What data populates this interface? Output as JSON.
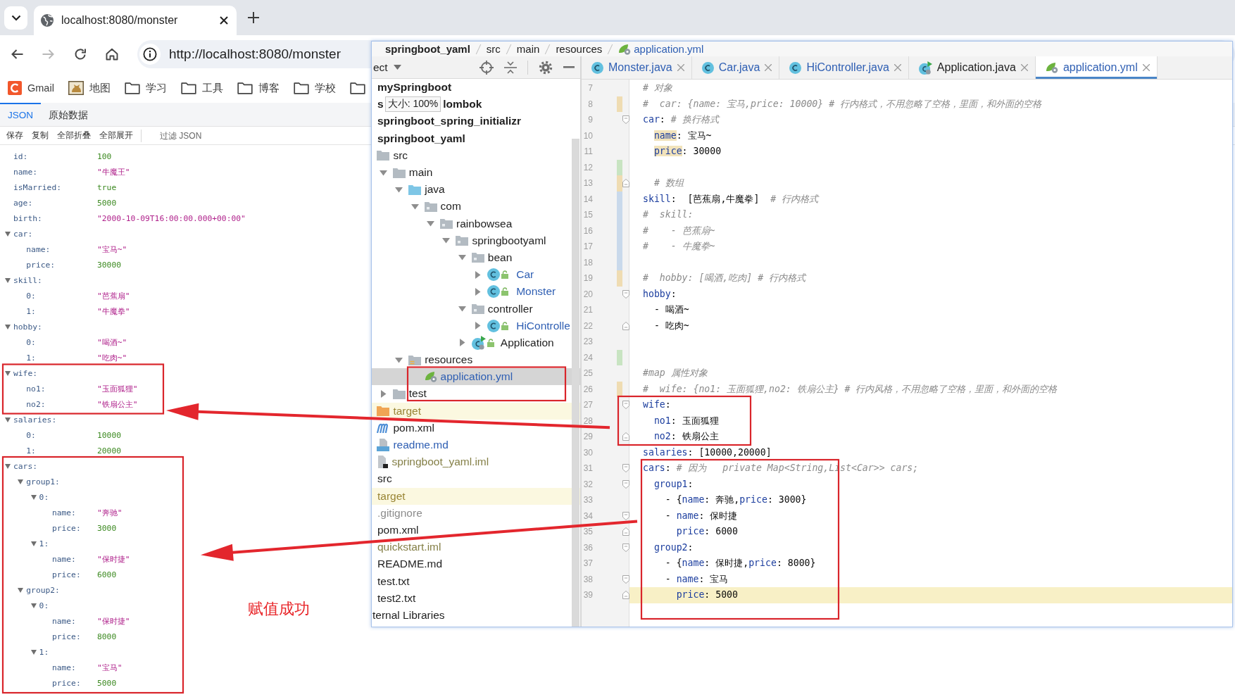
{
  "browser": {
    "tab": {
      "title": "localhost:8080/monster"
    },
    "nav_buttons": [
      {
        "kind": "back",
        "disabled": false
      },
      {
        "kind": "forward",
        "disabled": true
      },
      {
        "kind": "reload",
        "disabled": false
      },
      {
        "kind": "home",
        "disabled": false
      }
    ],
    "address_bar": {
      "url": "http://localhost:8080/monster"
    },
    "bookmarks": [
      {
        "label": "Gmail",
        "kind": "logo"
      },
      {
        "label": "地图",
        "kind": "picture"
      },
      {
        "label": "学习",
        "kind": "folder"
      },
      {
        "label": "工具",
        "kind": "folder"
      },
      {
        "label": "博客",
        "kind": "folder"
      },
      {
        "label": "学校",
        "kind": "folder"
      },
      {
        "kind": "folder"
      }
    ]
  },
  "json_viewer": {
    "tabs": [
      {
        "label": "JSON",
        "selected": true
      },
      {
        "label": "原始数据",
        "selected": false
      }
    ],
    "actions": [
      "保存",
      "复制",
      "全部折叠",
      "全部展开"
    ],
    "filter": {
      "placeholder": "过滤 JSON"
    },
    "tree": [
      {
        "key": "id:",
        "value": "100",
        "kind": "number"
      },
      {
        "key": "name:",
        "value": "\"牛魔王\"",
        "kind": "string"
      },
      {
        "key": "isMarried:",
        "value": "true",
        "kind": "boolean"
      },
      {
        "key": "age:",
        "value": "5000",
        "kind": "number"
      },
      {
        "key": "birth:",
        "value": "\"2000-10-09T16:00:00.000+00:00\"",
        "kind": "string"
      },
      {
        "key": "car:",
        "expanded": true,
        "children": [
          {
            "key": "name:",
            "value": "\"宝马~\"",
            "kind": "string"
          },
          {
            "key": "price:",
            "value": "30000",
            "kind": "number"
          }
        ]
      },
      {
        "key": "skill:",
        "expanded": true,
        "children": [
          {
            "key": "0:",
            "value": "\"芭蕉扇\"",
            "kind": "string"
          },
          {
            "key": "1:",
            "value": "\"牛魔拳\"",
            "kind": "string"
          }
        ]
      },
      {
        "key": "hobby:",
        "expanded": true,
        "children": [
          {
            "key": "0:",
            "value": "\"喝酒~\"",
            "kind": "string"
          },
          {
            "key": "1:",
            "value": "\"吃肉~\"",
            "kind": "string"
          }
        ]
      },
      {
        "key": "wife:",
        "expanded": true,
        "children": [
          {
            "key": "no1:",
            "value": "\"玉面狐狸\"",
            "kind": "string"
          },
          {
            "key": "no2:",
            "value": "\"铁扇公主\"",
            "kind": "string"
          }
        ]
      },
      {
        "key": "salaries:",
        "expanded": true,
        "children": [
          {
            "key": "0:",
            "value": "10000",
            "kind": "number"
          },
          {
            "key": "1:",
            "value": "20000",
            "kind": "number"
          }
        ]
      },
      {
        "key": "cars:",
        "expanded": true,
        "children": [
          {
            "key": "group1:",
            "expanded": true,
            "children": [
              {
                "key": "0:",
                "expanded": true,
                "children": [
                  {
                    "key": "name:",
                    "value": "\"奔驰\"",
                    "kind": "string"
                  },
                  {
                    "key": "price:",
                    "value": "3000",
                    "kind": "number"
                  }
                ]
              },
              {
                "key": "1:",
                "expanded": true,
                "children": [
                  {
                    "key": "name:",
                    "value": "\"保时捷\"",
                    "kind": "string"
                  },
                  {
                    "key": "price:",
                    "value": "6000",
                    "kind": "number"
                  }
                ]
              }
            ]
          },
          {
            "key": "group2:",
            "expanded": true,
            "children": [
              {
                "key": "0:",
                "expanded": true,
                "children": [
                  {
                    "key": "name:",
                    "value": "\"保时捷\"",
                    "kind": "string"
                  },
                  {
                    "key": "price:",
                    "value": "8000",
                    "kind": "number"
                  }
                ]
              },
              {
                "key": "1:",
                "expanded": true,
                "children": [
                  {
                    "key": "name:",
                    "value": "\"宝马\"",
                    "kind": "string"
                  },
                  {
                    "key": "price:",
                    "value": "5000",
                    "kind": "number"
                  }
                ]
              }
            ]
          }
        ]
      }
    ]
  },
  "ide": {
    "breadcrumb": [
      {
        "label": "springboot_yaml",
        "kind": "module"
      },
      {
        "label": "src",
        "kind": "folder"
      },
      {
        "label": "main",
        "kind": "folder"
      },
      {
        "label": "resources",
        "kind": "folder"
      },
      {
        "label": "application.yml",
        "kind": "yaml"
      }
    ],
    "project_panel": {
      "title": "ect",
      "tree": [
        {
          "label": "mySpringboot",
          "kind": "module",
          "color": "#1e1e1e",
          "selected": false
        },
        {
          "label": "s",
          "tooltip": "大小: 100%",
          "label_after": "lombok",
          "kind": "module",
          "color": "#1e1e1e",
          "selected": false
        },
        {
          "label": "springboot_spring_initializr",
          "kind": "module",
          "color": "#1e1e1e",
          "selected": false
        },
        {
          "label": "springboot_yaml",
          "kind": "module",
          "color": "#1e1e1e",
          "selected": false,
          "children": [
            {
              "label": "src",
              "kind": "folder",
              "color": "#1e1e1e",
              "selected": false,
              "children": [
                {
                  "label": "main",
                  "kind": "folder",
                  "expanded": true,
                  "color": "#1e1e1e",
                  "selected": false,
                  "children": [
                    {
                      "label": "java",
                      "kind": "source-folder",
                      "expanded": true,
                      "color": "#1e1e1e",
                      "selected": false,
                      "children": [
                        {
                          "label": "com",
                          "kind": "package",
                          "expanded": true,
                          "color": "#1e1e1e",
                          "selected": false,
                          "children": [
                            {
                              "label": "rainbowsea",
                              "kind": "package",
                              "expanded": true,
                              "color": "#1e1e1e",
                              "selected": false,
                              "children": [
                                {
                                  "label": "springbootyaml",
                                  "kind": "package",
                                  "expanded": true,
                                  "color": "#1e1e1e",
                                  "selected": false,
                                  "children": [
                                    {
                                      "label": "bean",
                                      "kind": "package",
                                      "expanded": true,
                                      "color": "#1e1e1e",
                                      "selected": false,
                                      "children": [
                                        {
                                          "label": "Car",
                                          "kind": "class",
                                          "expanded": false,
                                          "color": "#2f5fb3",
                                          "selected": false
                                        },
                                        {
                                          "label": "Monster",
                                          "kind": "class",
                                          "expanded": false,
                                          "color": "#2f5fb3",
                                          "selected": false
                                        }
                                      ]
                                    },
                                    {
                                      "label": "controller",
                                      "kind": "package",
                                      "expanded": true,
                                      "color": "#1e1e1e",
                                      "selected": false,
                                      "children": [
                                        {
                                          "label": "HiControlle",
                                          "kind": "class",
                                          "expanded": false,
                                          "color": "#2f5fb3",
                                          "selected": false
                                        }
                                      ]
                                    },
                                    {
                                      "label": "Application",
                                      "kind": "run-class",
                                      "expanded": false,
                                      "color": "#1e1e1e",
                                      "selected": false
                                    }
                                  ]
                                }
                              ]
                            }
                          ]
                        }
                      ]
                    },
                    {
                      "label": "resources",
                      "kind": "resources-folder",
                      "expanded": true,
                      "color": "#1e1e1e",
                      "selected": false,
                      "children": [
                        {
                          "label": "application.yml",
                          "kind": "yaml",
                          "color": "#2f5fb3",
                          "selected": true
                        }
                      ]
                    }
                  ]
                },
                {
                  "label": "test",
                  "kind": "folder",
                  "expanded": false,
                  "color": "#1e1e1e",
                  "selected": false
                }
              ]
            },
            {
              "label": "target",
              "kind": "excluded-folder",
              "color": "#9a8636",
              "selected": false
            },
            {
              "label": "pom.xml",
              "kind": "maven",
              "color": "#1e1e1e",
              "selected": false
            },
            {
              "label": "readme.md",
              "kind": "markdown",
              "color": "#2f5fb3",
              "selected": false
            },
            {
              "label": "springboot_yaml.iml",
              "kind": "iml",
              "color": "#858048",
              "selected": false
            }
          ]
        },
        {
          "label": "src",
          "kind": "folder",
          "color": "#1e1e1e",
          "selected": false
        },
        {
          "label": "target",
          "kind": "excluded-folder",
          "color": "#9a8636",
          "selected": false
        },
        {
          "label": ".gitignore",
          "kind": "file",
          "color": "#8c8c8c",
          "selected": false
        },
        {
          "label": "pom.xml",
          "kind": "file",
          "color": "#1e1e1e",
          "selected": false
        },
        {
          "label": "quickstart.iml",
          "kind": "file",
          "color": "#858048",
          "selected": false
        },
        {
          "label": "README.md",
          "kind": "file",
          "color": "#1e1e1e",
          "selected": false
        },
        {
          "label": "test.txt",
          "kind": "file",
          "color": "#1e1e1e",
          "selected": false
        },
        {
          "label": "test2.txt",
          "kind": "file",
          "color": "#1e1e1e",
          "selected": false
        },
        {
          "label": "ternal Libraries",
          "kind": "libraries",
          "color": "#1e1e1e",
          "selected": false
        }
      ]
    },
    "editor_tabs": [
      {
        "label": "Monster.java",
        "kind": "class",
        "color": "#2f5fb3",
        "selected": false
      },
      {
        "label": "Car.java",
        "kind": "class",
        "color": "#2f5fb3",
        "selected": false
      },
      {
        "label": "HiController.java",
        "kind": "class",
        "color": "#2f5fb3",
        "selected": false
      },
      {
        "label": "Application.java",
        "kind": "run-class",
        "color": "#1e1e1e",
        "selected": false
      },
      {
        "label": "application.yml",
        "kind": "yaml",
        "color": "#2f5fb3",
        "selected": true
      }
    ],
    "lines": [
      {
        "number": "7",
        "kind": "plain",
        "current": false,
        "tokens": [
          {
            "text": "# 对象",
            "kind": "comment"
          }
        ]
      },
      {
        "number": "8",
        "kind": "plain",
        "current": false,
        "color": "#efdcb2",
        "tokens": [
          {
            "text": "#  car: {name: 宝马,price: 10000} # 行内格式，不用忽略了空格，里面，和外面的空格",
            "kind": "comment"
          }
        ]
      },
      {
        "number": "9",
        "kind": "fold-start",
        "current": false,
        "tokens": [
          {
            "text": "car",
            "kind": "key"
          },
          {
            "text": ": ",
            "kind": "plain"
          },
          {
            "text": "# 换行格式",
            "kind": "comment"
          }
        ]
      },
      {
        "number": "10",
        "kind": "plain",
        "current": false,
        "tokens": [
          {
            "text": "  name",
            "kind": "usage"
          },
          {
            "text": ": 宝马~",
            "kind": "plain"
          }
        ]
      },
      {
        "number": "11",
        "kind": "plain",
        "current": false,
        "tokens": [
          {
            "text": "  price",
            "kind": "usage"
          },
          {
            "text": ": 30000",
            "kind": "plain"
          }
        ]
      },
      {
        "number": "12",
        "kind": "plain",
        "current": false,
        "color": "#c8e4c2"
      },
      {
        "number": "13",
        "kind": "fold-end",
        "current": false,
        "color": "#efdcb2",
        "tokens": [
          {
            "text": "  # 数组",
            "kind": "comment"
          }
        ]
      },
      {
        "number": "14",
        "kind": "plain",
        "current": false,
        "color": "#c9d9eb",
        "tokens": [
          {
            "text": "skill",
            "kind": "key"
          },
          {
            "text": ":  [芭蕉扇,牛魔拳]  ",
            "kind": "plain"
          },
          {
            "text": "# 行内格式",
            "kind": "comment"
          }
        ]
      },
      {
        "number": "15",
        "kind": "plain",
        "current": false,
        "color": "#c9d9eb",
        "tokens": [
          {
            "text": "#  skill:",
            "kind": "comment"
          }
        ]
      },
      {
        "number": "16",
        "kind": "plain",
        "current": false,
        "color": "#c9d9eb",
        "tokens": [
          {
            "text": "#    - 芭蕉扇~",
            "kind": "comment"
          }
        ]
      },
      {
        "number": "17",
        "kind": "plain",
        "current": false,
        "color": "#c9d9eb",
        "tokens": [
          {
            "text": "#    - 牛魔拳~",
            "kind": "comment"
          }
        ]
      },
      {
        "number": "18",
        "kind": "plain",
        "current": false,
        "color": "#c9d9eb"
      },
      {
        "number": "19",
        "kind": "plain",
        "current": false,
        "color": "#efdcb2",
        "tokens": [
          {
            "text": "#  hobby: [喝酒,吃肉] # 行内格式",
            "kind": "comment"
          }
        ]
      },
      {
        "number": "20",
        "kind": "fold-start",
        "current": false,
        "tokens": [
          {
            "text": "hobby",
            "kind": "key"
          },
          {
            "text": ":",
            "kind": "plain"
          }
        ]
      },
      {
        "number": "21",
        "kind": "plain",
        "current": false,
        "tokens": [
          {
            "text": "  - 喝酒~",
            "kind": "plain"
          }
        ]
      },
      {
        "number": "22",
        "kind": "fold-end",
        "current": false,
        "tokens": [
          {
            "text": "  - 吃肉~",
            "kind": "plain"
          }
        ]
      },
      {
        "number": "23",
        "kind": "plain",
        "current": false
      },
      {
        "number": "24",
        "kind": "plain",
        "current": false,
        "color": "#c8e4c2"
      },
      {
        "number": "25",
        "kind": "plain",
        "current": false,
        "tokens": [
          {
            "text": "#map 属性对象",
            "kind": "comment"
          }
        ]
      },
      {
        "number": "26",
        "kind": "plain",
        "current": false,
        "color": "#efdcb2",
        "tokens": [
          {
            "text": "#  wife: {no1: 玉面狐狸,no2: 铁扇公主} # 行内风格，不用忽略了空格，里面，和外面的空格",
            "kind": "comment"
          }
        ]
      },
      {
        "number": "27",
        "kind": "fold-start",
        "current": false,
        "tokens": [
          {
            "text": "wife",
            "kind": "key"
          },
          {
            "text": ":",
            "kind": "plain"
          }
        ]
      },
      {
        "number": "28",
        "kind": "plain",
        "current": false,
        "tokens": [
          {
            "text": "  no1",
            "kind": "key"
          },
          {
            "text": ": 玉面狐狸",
            "kind": "plain"
          }
        ]
      },
      {
        "number": "29",
        "kind": "fold-end",
        "current": false,
        "tokens": [
          {
            "text": "  no2",
            "kind": "key"
          },
          {
            "text": ": 铁扇公主",
            "kind": "plain"
          }
        ]
      },
      {
        "number": "30",
        "kind": "plain",
        "current": false,
        "tokens": [
          {
            "text": "salaries",
            "kind": "key"
          },
          {
            "text": ": [10000,20000]",
            "kind": "plain"
          }
        ]
      },
      {
        "number": "31",
        "kind": "fold-start",
        "current": false,
        "tokens": [
          {
            "text": "cars",
            "kind": "key"
          },
          {
            "text": ": ",
            "kind": "plain"
          },
          {
            "text": "# 因为   private Map<String,List<Car>> cars;",
            "kind": "comment"
          }
        ]
      },
      {
        "number": "32",
        "kind": "fold-start",
        "current": false,
        "tokens": [
          {
            "text": "  group1",
            "kind": "key"
          },
          {
            "text": ":",
            "kind": "plain"
          }
        ]
      },
      {
        "number": "33",
        "kind": "plain",
        "current": false,
        "tokens": [
          {
            "text": "    - {",
            "kind": "plain"
          },
          {
            "text": "name",
            "kind": "key"
          },
          {
            "text": ": 奔驰,",
            "kind": "plain"
          },
          {
            "text": "price",
            "kind": "key"
          },
          {
            "text": ": 3000}",
            "kind": "plain"
          }
        ]
      },
      {
        "number": "34",
        "kind": "fold-start",
        "current": false,
        "tokens": [
          {
            "text": "    - ",
            "kind": "plain"
          },
          {
            "text": "name",
            "kind": "key"
          },
          {
            "text": ": 保时捷",
            "kind": "plain"
          }
        ]
      },
      {
        "number": "35",
        "kind": "fold-end",
        "current": false,
        "tokens": [
          {
            "text": "      price",
            "kind": "key"
          },
          {
            "text": ": 6000",
            "kind": "plain"
          }
        ]
      },
      {
        "number": "36",
        "kind": "fold-start",
        "current": false,
        "tokens": [
          {
            "text": "  group2",
            "kind": "key"
          },
          {
            "text": ":",
            "kind": "plain"
          }
        ]
      },
      {
        "number": "37",
        "kind": "plain",
        "current": false,
        "tokens": [
          {
            "text": "    - {",
            "kind": "plain"
          },
          {
            "text": "name",
            "kind": "key"
          },
          {
            "text": ": 保时捷,",
            "kind": "plain"
          },
          {
            "text": "price",
            "kind": "key"
          },
          {
            "text": ": 8000}",
            "kind": "plain"
          }
        ]
      },
      {
        "number": "38",
        "kind": "fold-start",
        "current": false,
        "tokens": [
          {
            "text": "    - ",
            "kind": "plain"
          },
          {
            "text": "name",
            "kind": "key"
          },
          {
            "text": ": 宝马",
            "kind": "plain"
          }
        ]
      },
      {
        "number": "39",
        "kind": "fold-end",
        "current": true,
        "tokens": [
          {
            "text": "      price",
            "kind": "key"
          },
          {
            "text": ": 5000",
            "kind": "plain"
          }
        ]
      }
    ]
  },
  "annotation": {
    "label": "赋值成功"
  }
}
